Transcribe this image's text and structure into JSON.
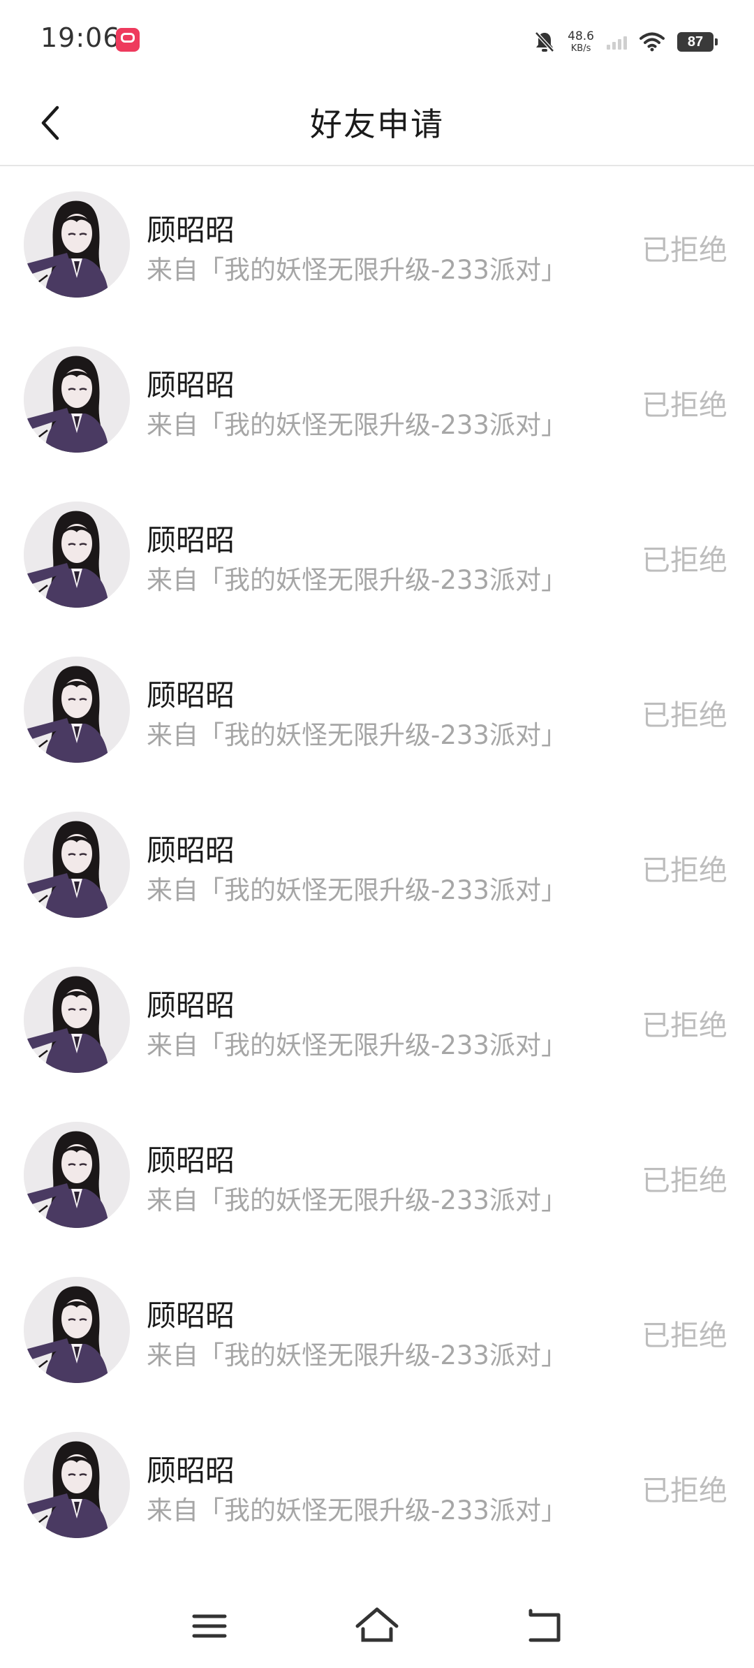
{
  "status_bar": {
    "time": "19:06",
    "net_speed_value": "48.6",
    "net_speed_unit": "KB/s",
    "battery": "87",
    "icons": [
      "app-notification-icon",
      "mute-bell-icon",
      "signal-icon",
      "wifi-icon",
      "battery-icon"
    ]
  },
  "header": {
    "title": "好友申请",
    "back_icon": "chevron-left-icon"
  },
  "requests": [
    {
      "name": "顾昭昭",
      "source": "来自「我的妖怪无限升级-233派对」",
      "status": "已拒绝"
    },
    {
      "name": "顾昭昭",
      "source": "来自「我的妖怪无限升级-233派对」",
      "status": "已拒绝"
    },
    {
      "name": "顾昭昭",
      "source": "来自「我的妖怪无限升级-233派对」",
      "status": "已拒绝"
    },
    {
      "name": "顾昭昭",
      "source": "来自「我的妖怪无限升级-233派对」",
      "status": "已拒绝"
    },
    {
      "name": "顾昭昭",
      "source": "来自「我的妖怪无限升级-233派对」",
      "status": "已拒绝"
    },
    {
      "name": "顾昭昭",
      "source": "来自「我的妖怪无限升级-233派对」",
      "status": "已拒绝"
    },
    {
      "name": "顾昭昭",
      "source": "来自「我的妖怪无限升级-233派对」",
      "status": "已拒绝"
    },
    {
      "name": "顾昭昭",
      "source": "来自「我的妖怪无限升级-233派对」",
      "status": "已拒绝"
    },
    {
      "name": "顾昭昭",
      "source": "来自「我的妖怪无限升级-233派对」",
      "status": "已拒绝"
    }
  ],
  "nav_bar": {
    "icons": [
      "menu-icon",
      "home-icon",
      "back-icon"
    ]
  }
}
